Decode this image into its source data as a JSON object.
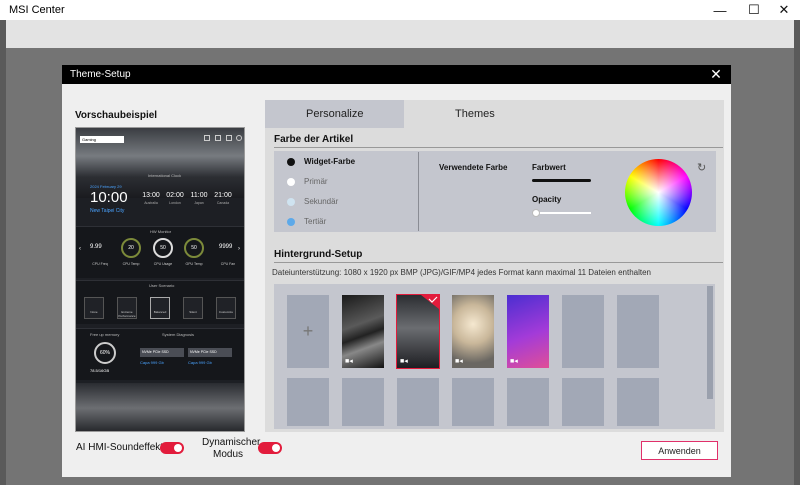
{
  "app": {
    "title": "MSI Center"
  },
  "window_controls": {
    "minimize": "—",
    "maximize": "☐",
    "close": "✕"
  },
  "dialog": {
    "title": "Theme-Setup",
    "close": "✕"
  },
  "preview": {
    "label": "Vorschaubeispiel",
    "dropdown": "Gaming",
    "section_international": "International Clock",
    "date": "2024 February 29",
    "time": "10:00",
    "city": "New Taipei City",
    "clocks": [
      {
        "time": "13:00",
        "city": "Australia"
      },
      {
        "time": "02:00",
        "city": "London"
      },
      {
        "time": "11:00",
        "city": "Japan"
      },
      {
        "time": "21:00",
        "city": "Canada"
      }
    ],
    "section_monitor": "HW Monitor",
    "gauges": [
      {
        "value": "9.99",
        "unit": "MHz",
        "label": "CPU Freq"
      },
      {
        "value": "20",
        "unit": "°C",
        "label": "CPU Temp"
      },
      {
        "value": "50",
        "unit": "%",
        "label": "CPU Usage"
      },
      {
        "value": "50",
        "unit": "°C",
        "label": "GPU Temp"
      },
      {
        "value": "9999",
        "unit": "RPM",
        "label": "CPU Fan"
      }
    ],
    "section_scenario": "User Scenario",
    "modes": [
      "None",
      "Extreme Performance",
      "Balanced",
      "Silent",
      "Customize"
    ],
    "section_memory": "Free up memory",
    "section_storage": "System Diagnosis",
    "memory_value": "78.5/16GB",
    "memory_percent": "60%",
    "storage": [
      {
        "name": "NVMe PCIe SSD",
        "value": "Capa 999 Gb"
      },
      {
        "name": "NVMe PCIe SSD",
        "value": "Capa 999 Gb"
      }
    ]
  },
  "toggles": {
    "ai_hmi": {
      "label": "AI HMI-Soundeffekt",
      "on": true
    },
    "dynamic": {
      "label": "Dynamischer Modus",
      "on": true
    }
  },
  "tabs": [
    {
      "label": "Personalize",
      "active": true
    },
    {
      "label": "Themes",
      "active": false
    }
  ],
  "color_section": {
    "title": "Farbe der Artikel",
    "options": [
      {
        "label": "Widget-Farbe",
        "color": "#111111",
        "selected": true
      },
      {
        "label": "Primär",
        "color": "#ffffff",
        "selected": false
      },
      {
        "label": "Sekundär",
        "color": "#cfe3f0",
        "selected": false
      },
      {
        "label": "Tertiär",
        "color": "#5da9e9",
        "selected": false
      }
    ],
    "used_color_label": "Verwendete Farbe",
    "color_value_label": "Farbwert",
    "opacity_label": "Opacity",
    "opacity": 0.0
  },
  "background_section": {
    "title": "Hintergrund-Setup",
    "info": "Dateiunterstützung: 1080 x 1920 px BMP (JPG)/GIF/MP4 jedes Format kann maximal 11 Dateien enthalten"
  },
  "apply_button": "Anwenden"
}
